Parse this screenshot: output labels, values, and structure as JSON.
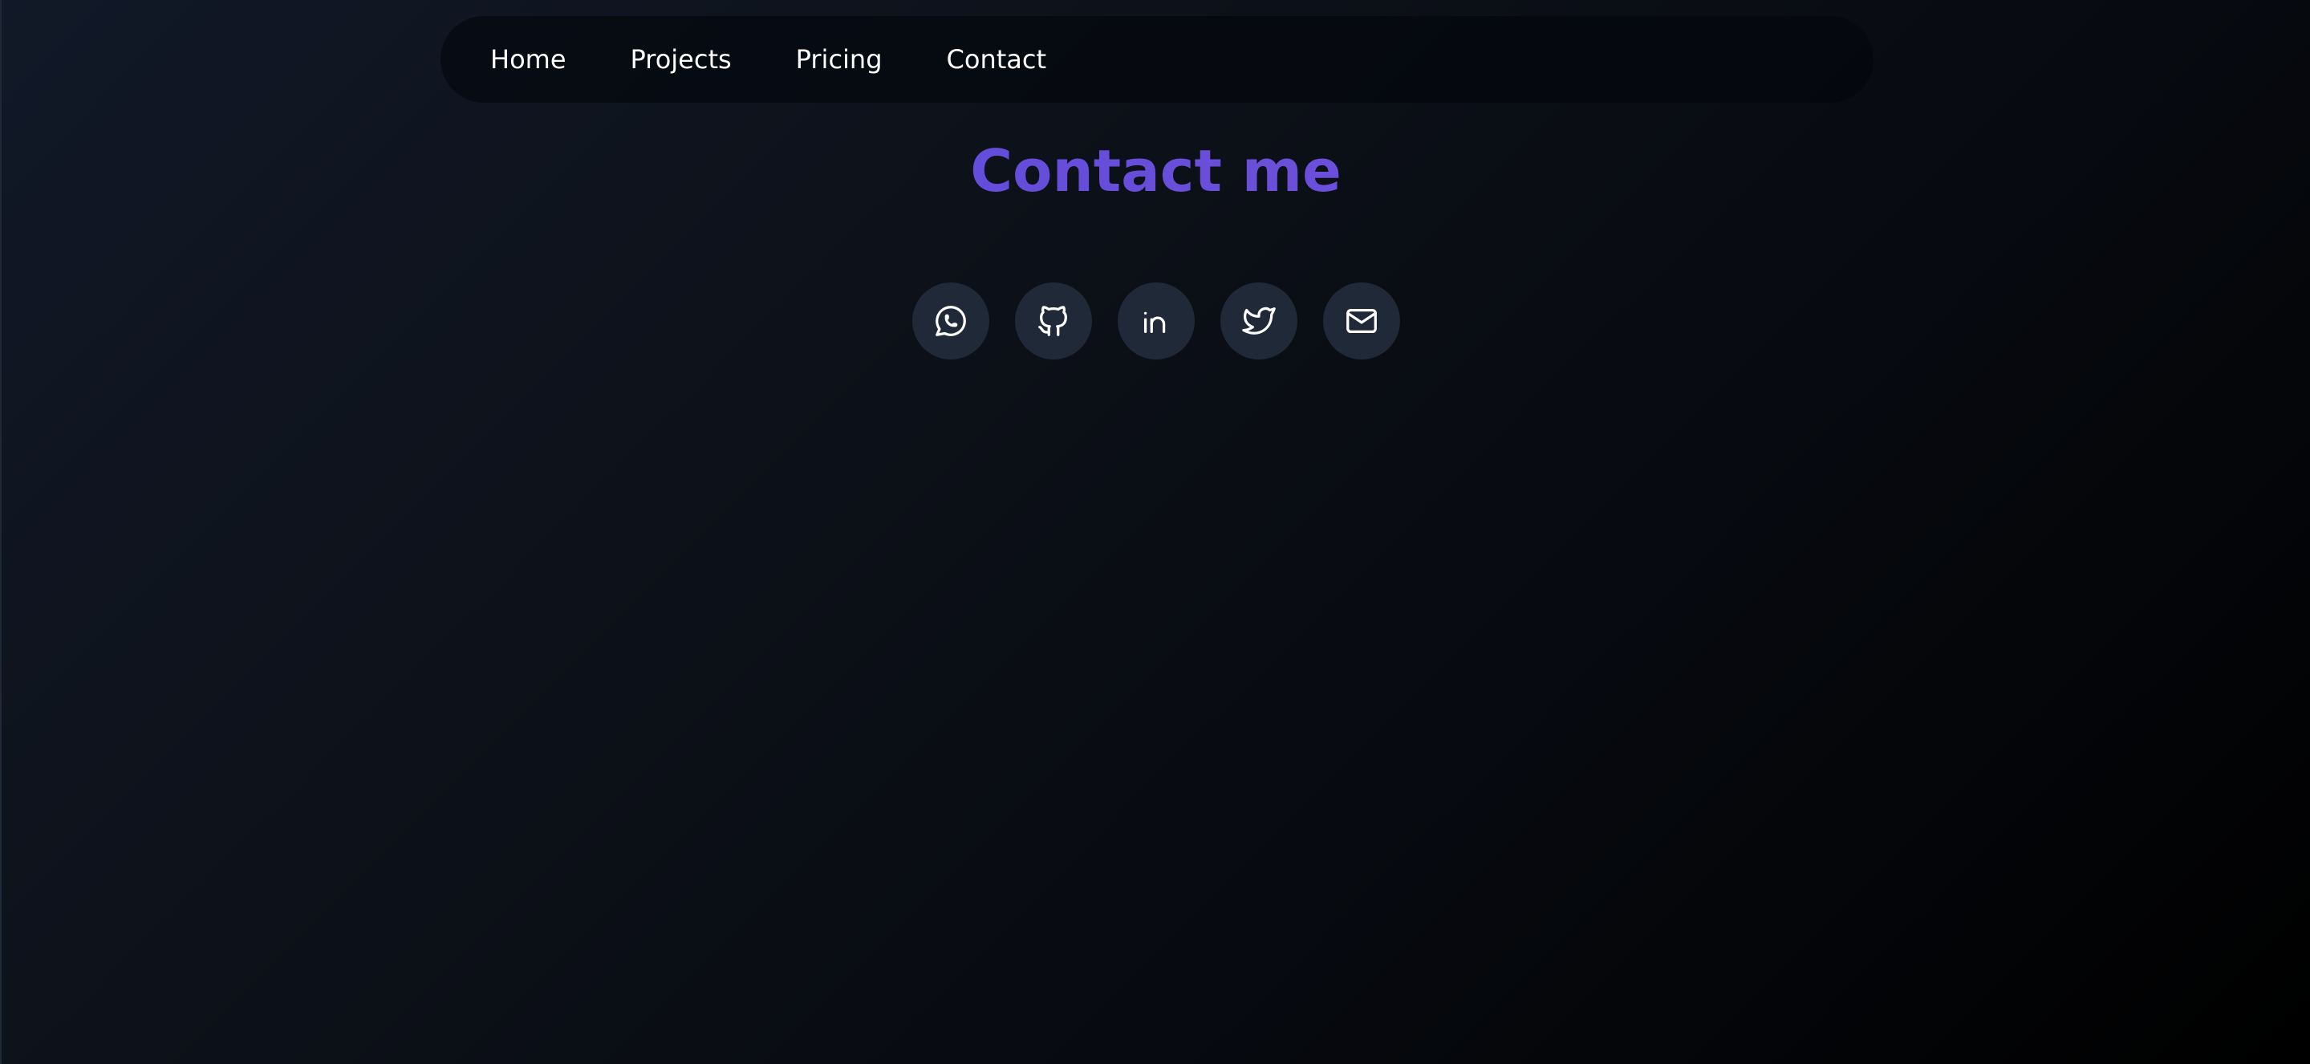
{
  "nav": {
    "items": [
      {
        "label": "Home"
      },
      {
        "label": "Projects"
      },
      {
        "label": "Pricing"
      },
      {
        "label": "Contact"
      }
    ]
  },
  "page": {
    "title": "Contact me"
  },
  "socials": [
    {
      "icon": "whatsapp-icon"
    },
    {
      "icon": "github-icon"
    },
    {
      "icon": "linkedin-icon"
    },
    {
      "icon": "twitter-icon"
    },
    {
      "icon": "mail-icon"
    }
  ],
  "colors": {
    "title_gradient_start": "#4f46e5",
    "title_gradient_end": "#7c3aed",
    "icon_button_bg": "#1f2937",
    "nav_text": "#ffffff"
  }
}
